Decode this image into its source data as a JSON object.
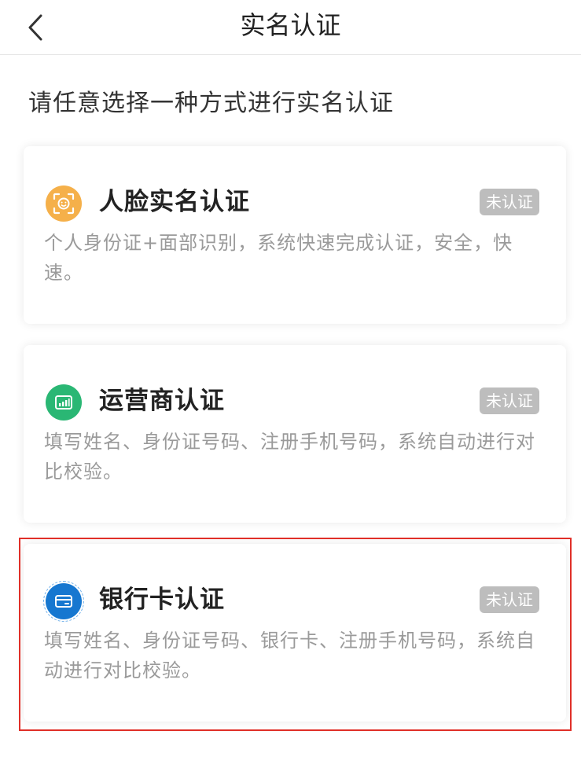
{
  "header": {
    "title": "实名认证",
    "back_icon": "chevron-left-icon"
  },
  "instruction": "请任意选择一种方式进行实名认证",
  "methods": [
    {
      "title": "人脸实名认证",
      "badge": "未认证",
      "description": "个人身份证+面部识别，系统快速完成认证，安全，快速。",
      "icon": "face-scan-icon",
      "icon_color": "#f5b04a"
    },
    {
      "title": "运营商认证",
      "badge": "未认证",
      "description": "填写姓名、身份证号码、注册手机号码，系统自动进行对比校验。",
      "icon": "signal-icon",
      "icon_color": "#2ab774"
    },
    {
      "title": "银行卡认证",
      "badge": "未认证",
      "description": "填写姓名、身份证号码、银行卡、注册手机号码，系统自动进行对比校验。",
      "icon": "bank-card-icon",
      "icon_color": "#1677d0"
    }
  ],
  "colors": {
    "badge_bg": "#bdbdbd",
    "highlight_border": "#e02f28"
  }
}
